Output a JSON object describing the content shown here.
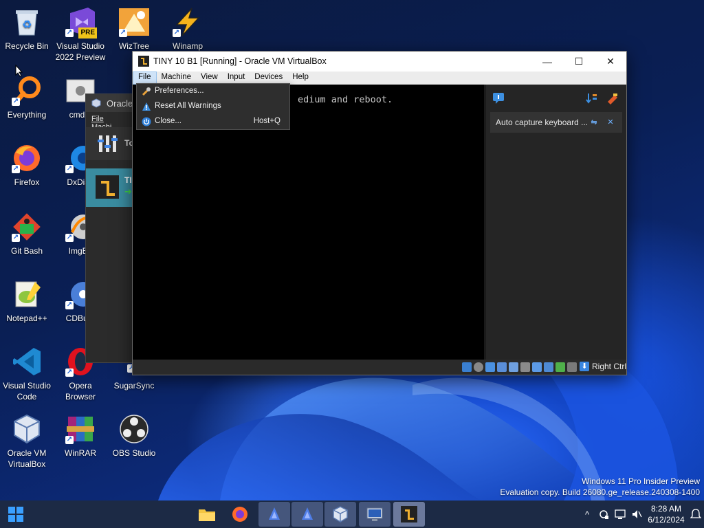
{
  "desktop": {
    "icons": [
      {
        "label": "Recycle Bin"
      },
      {
        "label": "Visual Studio 2022 Preview",
        "badge": "PRE"
      },
      {
        "label": "WizTree"
      },
      {
        "label": "Winamp"
      },
      {
        "label": "Everything"
      },
      {
        "label": "cmd.b"
      },
      {
        "label": "Firefox"
      },
      {
        "label": "DxDiag"
      },
      {
        "label": "Git Bash"
      },
      {
        "label": "ImgBu"
      },
      {
        "label": "Notepad++"
      },
      {
        "label": "CDBurn"
      },
      {
        "label": "Visual Studio Code"
      },
      {
        "label": "Opera Browser"
      },
      {
        "label": "SugarSync"
      },
      {
        "label": "Oracle VM VirtualBox"
      },
      {
        "label": "WinRAR"
      },
      {
        "label": "OBS Studio"
      }
    ]
  },
  "manager_window": {
    "title": "Oracle",
    "menu": [
      "File",
      "Machi"
    ],
    "tools_label": "To",
    "vm_label": "TI"
  },
  "vm_window": {
    "title": "TINY 10 B1 [Running] - Oracle VM VirtualBox",
    "controls": {
      "minimize": "—",
      "maximize": "☐",
      "close": "✕"
    },
    "menu": [
      "File",
      "Machine",
      "View",
      "Input",
      "Devices",
      "Help"
    ],
    "console_text": "edium and reboot.",
    "notification": {
      "text": "Auto capture keyboard ...",
      "btn_a": "⇋",
      "btn_b": "✕"
    },
    "host_key": "Right Ctrl"
  },
  "file_menu": {
    "items": [
      {
        "label": "Preferences...",
        "shortcut": ""
      },
      {
        "label": "Reset All Warnings",
        "shortcut": ""
      },
      {
        "label": "Close...",
        "shortcut": "Host+Q"
      }
    ]
  },
  "watermark": {
    "line1": "Windows 11 Pro Insider Preview",
    "line2": "Evaluation copy. Build 26080.ge_release.240308-1400"
  },
  "taskbar": {
    "clock_time": "8:28 AM",
    "clock_date": "6/12/2024",
    "tray_chevron": "^"
  },
  "colors": {
    "accent": "#1a5fd6",
    "menu_active": "#cfe3f8",
    "vm_selected": "#3a8ca0"
  }
}
